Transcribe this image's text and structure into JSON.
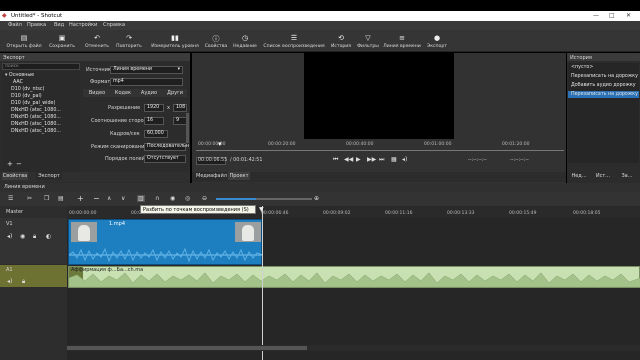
{
  "window": {
    "title": "Untitled* - Shotcut",
    "min": "—",
    "max": "□",
    "close": "✕"
  },
  "menu": [
    "Файл",
    "Правка",
    "Вид",
    "Настройки",
    "Справка"
  ],
  "toolbar": [
    {
      "label": "Открыть файл",
      "icon": "folder-icon",
      "glyph": "▤"
    },
    {
      "label": "Сохранить",
      "icon": "save-icon",
      "glyph": "▣"
    },
    {
      "label": "Отменить",
      "icon": "undo-icon",
      "glyph": "↶"
    },
    {
      "label": "Повторить",
      "icon": "redo-icon",
      "glyph": "↷"
    },
    {
      "label": "Измеритель уровня",
      "icon": "meter-icon",
      "glyph": "▮▮"
    },
    {
      "label": "Свойства",
      "icon": "info-icon",
      "glyph": "ⓘ"
    },
    {
      "label": "Недавние",
      "icon": "clock-icon",
      "glyph": "◷"
    },
    {
      "label": "Список воспроизведения",
      "icon": "playlist-icon",
      "glyph": "☰"
    },
    {
      "label": "История",
      "icon": "history-icon",
      "glyph": "⟲"
    },
    {
      "label": "Фильтры",
      "icon": "filter-icon",
      "glyph": "▽"
    },
    {
      "label": "Линия времени",
      "icon": "timeline-icon",
      "glyph": "≡"
    },
    {
      "label": "Экспорт",
      "icon": "export-icon",
      "glyph": "●"
    }
  ],
  "export_panel": {
    "title": "Экспорт",
    "search_placeholder": "поиск",
    "presets": [
      "▾ Основные",
      "AAC",
      "D10 (dv_ntsc)",
      "D10 (dv_pal)",
      "D10 (dv_pal_wide)",
      "DNxHD (atsc_1080...",
      "DNxHD (atsc_1080...",
      "DNxHD (atsc_1080...",
      "DNxHD (atsc_1080..."
    ],
    "add": "+",
    "remove": "−",
    "tabs": [
      "Свойства",
      "Экспорт"
    ],
    "source_label": "Источник",
    "source_value": "Линия времени",
    "format_label": "Формат",
    "format_value": "mp4",
    "subtabs": [
      "Видео",
      "Кодек",
      "Аудио",
      "Други"
    ],
    "resolution_label": "Разрешение",
    "res_w": "1920",
    "res_x": "x",
    "res_h": "108",
    "aspect_label": "Соотношение сторон",
    "aspect_a": "16",
    "aspect_b": "9",
    "fps_label": "Кадров/сек",
    "fps_value": "60,000",
    "scan_label": "Режим сканирования",
    "scan_value": "Последовательн",
    "field_label": "Порядок полей",
    "field_value": "Отсутствует"
  },
  "player": {
    "time_current": "00:00:06:55",
    "time_total": "/ 00:01:42:51",
    "ticks": [
      "00:00:00:00",
      "00:00:20:00",
      "00:00:40:00",
      "00:01:00:00",
      "00:01:20:00"
    ],
    "in_point": "--:--:--:--",
    "out_point": "--:--:--:--",
    "tabs": [
      "Медиафайл",
      "Проект"
    ],
    "playhead_fraction": 0.068
  },
  "history": {
    "title": "История",
    "items": [
      "<пусто>",
      "Перезаписать на дорожку",
      "Добавить аудио дорожку",
      "Перезаписать на дорожку"
    ],
    "selected": 3,
    "tabs": [
      "Нед...",
      "Ист...",
      "За..."
    ]
  },
  "timeline": {
    "title": "Линия времени",
    "tooltip": "Разбить по точкам воспроизведения (S)",
    "master": "Master",
    "ruler": [
      "00:00:00:00",
      "00:00:04:37",
      "00:00:09:02",
      "00:00:11:16",
      "00:00:13:33",
      "00:00:15:49",
      "00:00:18:05"
    ],
    "ruler_playhead": "00:00:06:46",
    "tracks": [
      {
        "name": "V1",
        "clip": "1.mp4"
      },
      {
        "name": "A1",
        "clip": "Аффирмация ф...Ба...ch.ma"
      }
    ],
    "colors": {
      "video": "#1d7fc0",
      "audio": "#c9e0b3",
      "accent": "#2a72b5"
    }
  }
}
